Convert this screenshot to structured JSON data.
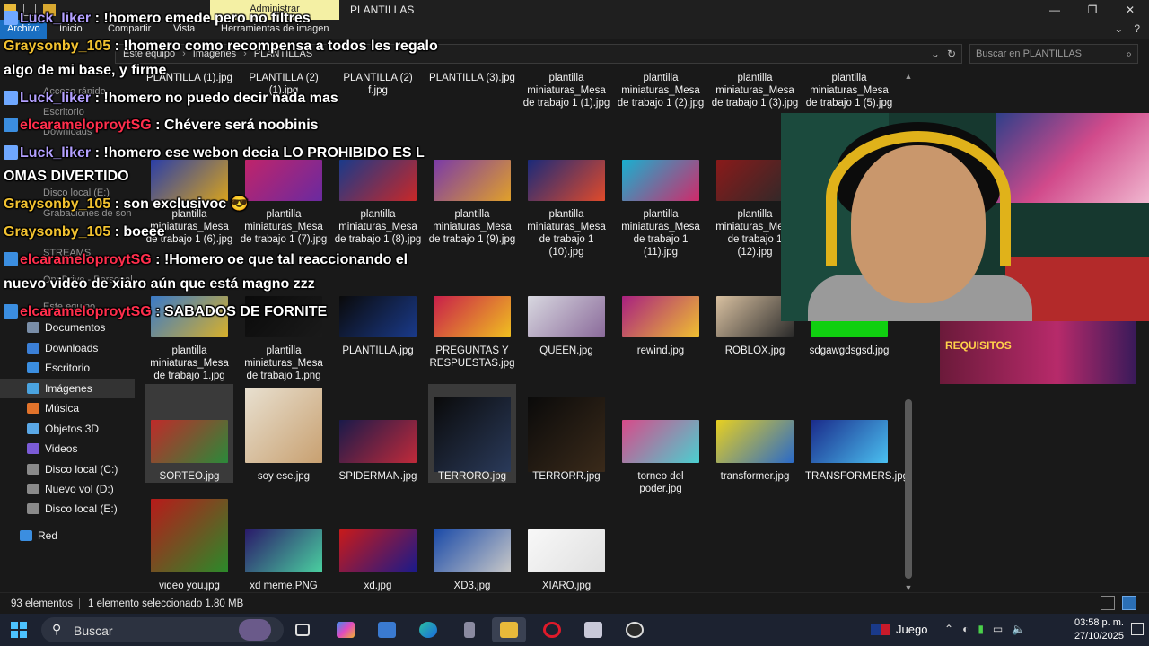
{
  "window": {
    "title": "PLANTILLAS",
    "context_tab": "Administrar",
    "controls": [
      "—",
      "❐",
      "✕"
    ]
  },
  "ribbon": {
    "tabs": [
      "Archivo",
      "Inicio",
      "Compartir",
      "Vista",
      "Herramientas de imagen"
    ]
  },
  "address": {
    "breadcrumb": [
      "Este equipo",
      "Imágenes",
      "PLANTILLAS"
    ],
    "search_placeholder": "Buscar en PLANTILLAS"
  },
  "nav": {
    "faint_items": [
      "Acceso rápido",
      "Escritorio",
      "Downloads",
      "Disco local (E:)",
      "Grabaciones de son",
      "STREAMS",
      "OneDrive - Personal",
      "Este equipo"
    ],
    "items": [
      {
        "label": "Documentos",
        "color": "#7a8ea8"
      },
      {
        "label": "Downloads",
        "color": "#3b7fd6"
      },
      {
        "label": "Escritorio",
        "color": "#3b8ee0"
      },
      {
        "label": "Imágenes",
        "color": "#4aa3df"
      },
      {
        "label": "Música",
        "color": "#e2732b"
      },
      {
        "label": "Objetos 3D",
        "color": "#5aa8e6"
      },
      {
        "label": "Videos",
        "color": "#7b5bd6"
      },
      {
        "label": "Disco local (C:)",
        "color": "#8a8a8a"
      },
      {
        "label": "Nuevo vol (D:)",
        "color": "#8a8a8a"
      },
      {
        "label": "Disco local (E:)",
        "color": "#8a8a8a"
      },
      {
        "label": "Red",
        "color": "#3b8ee0"
      }
    ],
    "selected": "Imágenes"
  },
  "files": [
    {
      "name": "PLANTILLA (1).jpg",
      "thumb": [
        "#222",
        "#222"
      ],
      "has_thumb": false
    },
    {
      "name": "PLANTILLA (2) (1).jpg",
      "thumb": [
        "#222",
        "#222"
      ],
      "has_thumb": false
    },
    {
      "name": "PLANTILLA (2) f.jpg",
      "thumb": [
        "#222",
        "#222"
      ],
      "has_thumb": false
    },
    {
      "name": "PLANTILLA (3).jpg",
      "thumb": [
        "#222",
        "#222"
      ],
      "has_thumb": false
    },
    {
      "name": "plantilla miniaturas_Mesa de trabajo 1 (1).jpg",
      "thumb": [
        "#222",
        "#222"
      ],
      "has_thumb": false
    },
    {
      "name": "plantilla miniaturas_Mesa de trabajo 1 (2).jpg",
      "thumb": [
        "#222",
        "#222"
      ],
      "has_thumb": false
    },
    {
      "name": "plantilla miniaturas_Mesa de trabajo 1 (3).jpg",
      "thumb": [
        "#222",
        "#222"
      ],
      "has_thumb": false
    },
    {
      "name": "plantilla miniaturas_Mesa de trabajo 1 (5).jpg",
      "thumb": [
        "#222",
        "#222"
      ],
      "has_thumb": false
    },
    {
      "name": "plantilla miniaturas_Mesa de trabajo 1 (6).jpg",
      "thumb": [
        "#2a3ea8",
        "#d6a21e"
      ],
      "has_thumb": true
    },
    {
      "name": "plantilla miniaturas_Mesa de trabajo 1 (7).jpg",
      "thumb": [
        "#c0246a",
        "#6a2aa0"
      ],
      "has_thumb": true
    },
    {
      "name": "plantilla miniaturas_Mesa de trabajo 1 (8).jpg",
      "thumb": [
        "#1a3a8a",
        "#c82828"
      ],
      "has_thumb": true
    },
    {
      "name": "plantilla miniaturas_Mesa de trabajo 1 (9).jpg",
      "thumb": [
        "#7a3aa8",
        "#e0a02a"
      ],
      "has_thumb": true
    },
    {
      "name": "plantilla miniaturas_Mesa de trabajo 1 (10).jpg",
      "thumb": [
        "#1a2a7a",
        "#e04a2a"
      ],
      "has_thumb": true
    },
    {
      "name": "plantilla miniaturas_Mesa de trabajo 1 (11).jpg",
      "thumb": [
        "#18b0d0",
        "#d02a6a"
      ],
      "has_thumb": true
    },
    {
      "name": "plantilla miniaturas_Mesa de trabajo 1 (12).jpg",
      "thumb": [
        "#8a1a1a",
        "#2a2a2a"
      ],
      "has_thumb": true
    },
    {
      "name": "plantilla miniaturas_Mesa de trabajo 1.jpg",
      "thumb": [
        "#3a7ac8",
        "#d8b02a"
      ],
      "has_thumb": true
    },
    {
      "name": "plantilla miniaturas_Mesa de trabajo 1.png",
      "thumb": [
        "#0a0a0a",
        "#1a1a1a"
      ],
      "has_thumb": true
    },
    {
      "name": "PLANTILLA.jpg",
      "thumb": [
        "#0a0a0a",
        "#1a3a8a"
      ],
      "has_thumb": true
    },
    {
      "name": "PREGUNTAS Y RESPUESTAS.jpg",
      "thumb": [
        "#c81e4a",
        "#f0c020"
      ],
      "has_thumb": true
    },
    {
      "name": "QUEEN.jpg",
      "thumb": [
        "#d8d8e0",
        "#8a6a9a"
      ],
      "has_thumb": true
    },
    {
      "name": "rewind.jpg",
      "thumb": [
        "#a82080",
        "#f0c030"
      ],
      "has_thumb": true
    },
    {
      "name": "ROBLOX.jpg",
      "thumb": [
        "#d8c0a0",
        "#2a2a2a"
      ],
      "has_thumb": true
    },
    {
      "name": "sdgawgdsgsd.jpg",
      "thumb": [
        "#10d010",
        "#10d010"
      ],
      "has_thumb": true
    },
    {
      "name": "SORTEO.jpg",
      "thumb": [
        "#c02a2a",
        "#2a8a3a"
      ],
      "has_thumb": true,
      "selected": true
    },
    {
      "name": "soy ese.jpg",
      "thumb": [
        "#e8e0d0",
        "#c8a070"
      ],
      "has_thumb": true
    },
    {
      "name": "SPIDERMAN.jpg",
      "thumb": [
        "#1a1a4a",
        "#c02a3a"
      ],
      "has_thumb": true
    },
    {
      "name": "TERRORO.jpg",
      "thumb": [
        "#0a0a0a",
        "#2a3a5a"
      ],
      "has_thumb": true,
      "hover": true
    },
    {
      "name": "TERRORR.jpg",
      "thumb": [
        "#0a0a0a",
        "#3a2a1a"
      ],
      "has_thumb": true
    },
    {
      "name": "torneo del poder.jpg",
      "thumb": [
        "#d84a8a",
        "#4ad0d0"
      ],
      "has_thumb": true
    },
    {
      "name": "transformer.jpg",
      "thumb": [
        "#e8d020",
        "#2a6ac8"
      ],
      "has_thumb": true
    },
    {
      "name": "TRANSFORMERS.jpg",
      "thumb": [
        "#1a2a8a",
        "#4ac0f0"
      ],
      "has_thumb": true
    },
    {
      "name": "video you.jpg",
      "thumb": [
        "#b81a1a",
        "#2a8a2a"
      ],
      "has_thumb": true
    },
    {
      "name": "xd meme.PNG",
      "thumb": [
        "#2a1a6a",
        "#4ad0a0"
      ],
      "has_thumb": true
    },
    {
      "name": "xd.jpg",
      "thumb": [
        "#c81a1a",
        "#1a1a8a"
      ],
      "has_thumb": true
    },
    {
      "name": "XD3.jpg",
      "thumb": [
        "#1a4aa8",
        "#c8c8c8"
      ],
      "has_thumb": true
    },
    {
      "name": "XIARO.jpg",
      "thumb": [
        "#f8f8f8",
        "#e0e0e0"
      ],
      "has_thumb": true
    }
  ],
  "status": {
    "count": "93 elementos",
    "selection": "1 elemento seleccionado  1.80 MB"
  },
  "taskbar": {
    "search_label": "Buscar",
    "game_label": "Juego",
    "time": "03:58 p. m.",
    "date": "27/10/2025"
  },
  "overlay": {
    "requirements_title": "REQUISITOS"
  },
  "chat": [
    {
      "user": "Luck_liker",
      "user_class": "u-luck",
      "text": " : !homero emede pero no filtres",
      "badge": "#6fa8ff"
    },
    {
      "user": "Graysonby_105",
      "user_class": "u-gray",
      "text": " : !homero como recompensa a todos les regalo",
      "badge": null
    },
    {
      "user": "",
      "user_class": "",
      "text": "algo de mi base, y firme",
      "badge": null
    },
    {
      "user": "Luck_liker",
      "user_class": "u-luck",
      "text": " : !homero no puedo decir nada mas",
      "badge": "#6fa8ff"
    },
    {
      "user": "elcarameloproytSG",
      "user_class": "u-elca",
      "text": " : Chévere será noobinis",
      "badge": "#3b8ee0"
    },
    {
      "user": "Luck_liker",
      "user_class": "u-luck",
      "text": " : !homero ese webon decia LO PROHIBIDO ES L",
      "badge": "#6fa8ff"
    },
    {
      "user": "",
      "user_class": "",
      "text": "OMAS DIVERTIDO",
      "badge": null
    },
    {
      "user": "Graysonby_105",
      "user_class": "u-gray",
      "text": " : son exclusivoc 😎",
      "badge": null
    },
    {
      "user": "Graysonby_105",
      "user_class": "u-gray",
      "text": " : boeee",
      "badge": null
    },
    {
      "user": "elcarameloproytSG",
      "user_class": "u-elca",
      "text": " : !Homero oe que tal reaccionando el",
      "badge": "#3b8ee0"
    },
    {
      "user": "",
      "user_class": "",
      "text": "nuevo video de xiaro aún que está magno zzz",
      "badge": null
    },
    {
      "user": "elcarameloproytSG",
      "user_class": "u-elca",
      "text": " : SABADOS DE FORNITE",
      "badge": "#3b8ee0"
    }
  ]
}
